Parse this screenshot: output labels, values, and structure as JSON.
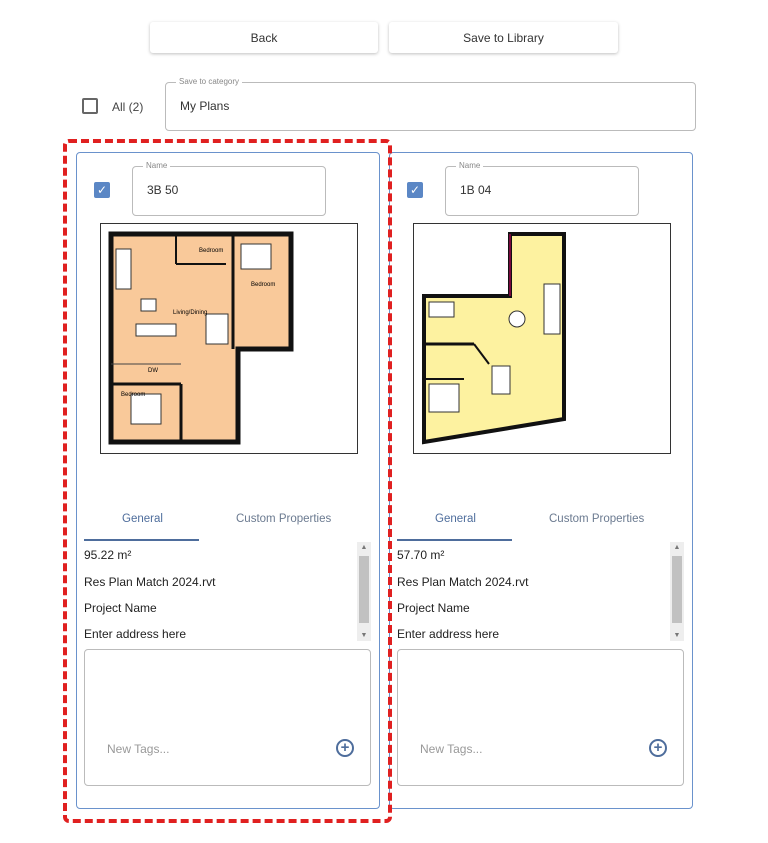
{
  "toolbar": {
    "back_label": "Back",
    "save_label": "Save to Library"
  },
  "select_all": {
    "label": "All (2)",
    "checked": false
  },
  "category": {
    "label": "Save to category",
    "value": "My Plans"
  },
  "colors": {
    "accent": "#5b87c5",
    "selection_outline": "#e02020",
    "plan1_fill": "#f9c99a",
    "plan2_fill": "#fdf2a0"
  },
  "cards": [
    {
      "checked": true,
      "name_label": "Name",
      "name": "3B 50",
      "tabs": [
        "General",
        "Custom Properties"
      ],
      "active_tab": "General",
      "plan_labels": [
        "Bedroom",
        "Bedroom",
        "Living/Dining",
        "DW",
        "Bedroom"
      ],
      "properties": [
        "95.22 m²",
        "Res Plan Match 2024.rvt",
        "Project Name",
        "Enter address here"
      ],
      "tags_placeholder": "New Tags...",
      "selected": true
    },
    {
      "checked": true,
      "name_label": "Name",
      "name": "1B 04",
      "tabs": [
        "General",
        "Custom Properties"
      ],
      "active_tab": "General",
      "properties": [
        "57.70 m²",
        "Res Plan Match 2024.rvt",
        "Project Name",
        "Enter address here"
      ],
      "tags_placeholder": "New Tags...",
      "selected": false
    }
  ]
}
